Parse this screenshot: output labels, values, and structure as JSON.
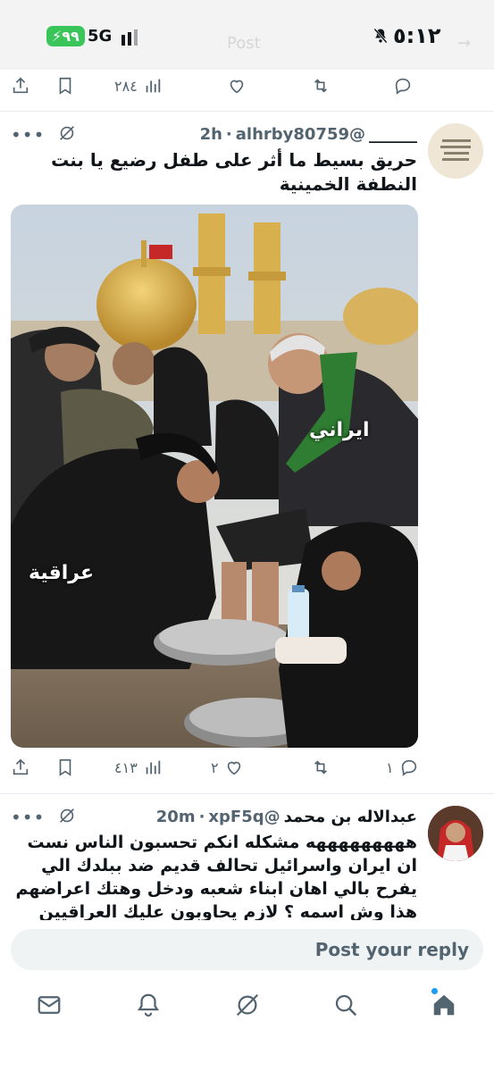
{
  "status_bar": {
    "time": "٥:١٢",
    "network": "5G",
    "battery": "٩٩",
    "faded_left": "Post",
    "faded_right": "→"
  },
  "top_actions": {
    "views": "٢٨٤"
  },
  "tweet1": {
    "name": "______",
    "handle": "@alhrby80759",
    "time": "2h",
    "text": "حريق بسيط ما أثر على طفل رضيع يا بنت النطفة الخمينية",
    "image_labels": {
      "left": "عراقية",
      "right": "ايراني"
    },
    "views": "٤١٣",
    "likes": "٢",
    "retweets": "",
    "replies": "١"
  },
  "tweet2": {
    "name": "عبدالاله بن محمد",
    "handle": "@xpF5q",
    "time": "20m",
    "text": "هههههههههه مشكله انكم تحسبون الناس نست ان ايران واسرائيل تحالف قديم ضد ببلدك الي يفرح بالي اهان ابناء شعبه ودخل وهتك اعراضهم هذا وش اسمه ؟ لازم يحاوبون عليك العراقيين"
  },
  "reply": {
    "placeholder": "Post your reply"
  },
  "colors": {
    "accent": "#1d9bf0",
    "icon": "#536471",
    "battery": "#3ac55a"
  }
}
